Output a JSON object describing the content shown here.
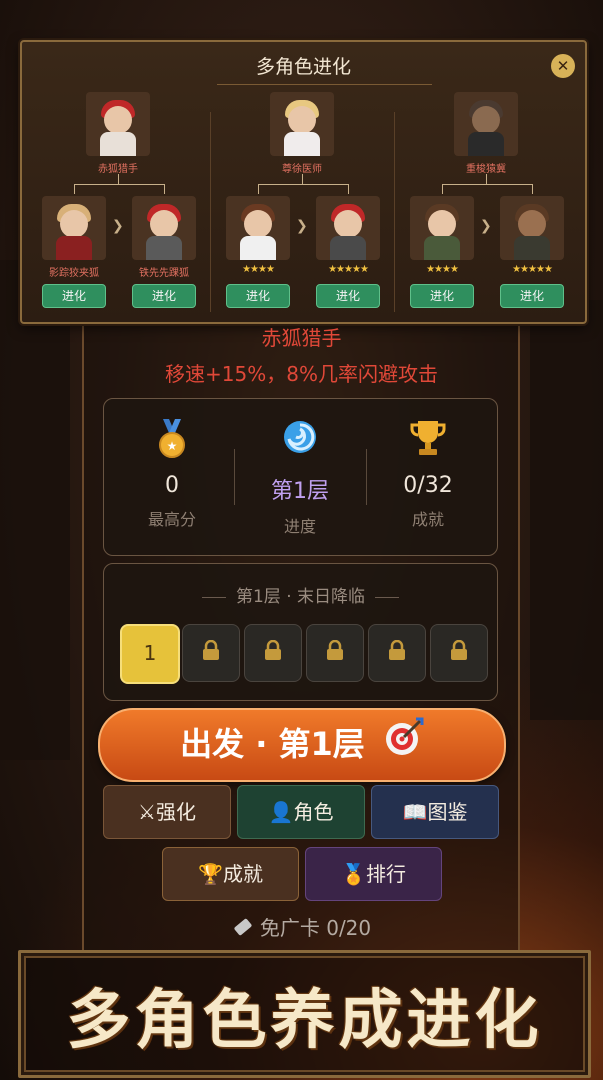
{
  "modal": {
    "title": "多角色进化",
    "close_symbol": "✕",
    "characters": [
      {
        "base_name": "赤狐猎手",
        "from_name": "影踪狡夹狐",
        "to_name": "铁先先踝狐",
        "from_stars": "",
        "to_stars": "",
        "evolve_label": "进化"
      },
      {
        "base_name": "尊徐医师",
        "from_name": "",
        "to_name": "",
        "from_stars": "★★★★",
        "to_stars": "★★★★★",
        "evolve_label": "进化"
      },
      {
        "base_name": "重梭猿冀",
        "from_name": "",
        "to_name": "",
        "from_stars": "★★★★",
        "to_stars": "★★★★★",
        "evolve_label": "进化"
      }
    ]
  },
  "skill": {
    "name": "赤狐猎手",
    "description": "移速+15%，8%几率闪避攻击"
  },
  "stats": [
    {
      "icon": "medal-icon",
      "value": "0",
      "label": "最高分"
    },
    {
      "icon": "vortex-icon",
      "value": "第1层",
      "label": "进度"
    },
    {
      "icon": "trophy-icon",
      "value": "0/32",
      "label": "成就"
    }
  ],
  "levels": {
    "title": "第1层 · 末日降临",
    "active": "1",
    "locked_count": 5
  },
  "go_button": {
    "label": "出发 · 第1层",
    "icon": "target-icon"
  },
  "menu": {
    "strength": {
      "icon": "⚔",
      "label": "强化"
    },
    "role": {
      "icon": "👤",
      "label": "角色"
    },
    "dex": {
      "icon": "📖",
      "label": "图鉴"
    },
    "achievement": {
      "icon": "🏆",
      "label": "成就"
    },
    "rank": {
      "icon": "🏅",
      "label": "排行"
    }
  },
  "ad_card": {
    "label": "免广卡 0/20"
  },
  "banner": {
    "text": "多角色养成进化"
  },
  "colors": {
    "accent_orange": "#e0641e",
    "evolve_green": "#2f8f5e",
    "skill_red": "#e04838",
    "gold": "#e6c23a"
  }
}
